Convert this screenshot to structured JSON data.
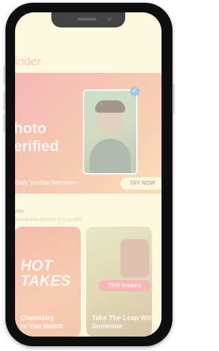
{
  "app": {
    "title_partial": "inder",
    "accent_color": "#f0b7a5"
  },
  "promo": {
    "title": "hoto\nerified",
    "subtitle": "Only Verified Members",
    "button_label": "TRY NOW",
    "verified_icon": "check-badge-icon"
  },
  "section": {
    "heading": "me",
    "subheading": "tereaction bootst you profile"
  },
  "cards": [
    {
      "overlay_text": "HOT\nTAKES",
      "title": "Chemistry\nre You Match"
    },
    {
      "badge": "Thrill Seekers",
      "title": "Take The Leap With\nSomeone"
    }
  ]
}
